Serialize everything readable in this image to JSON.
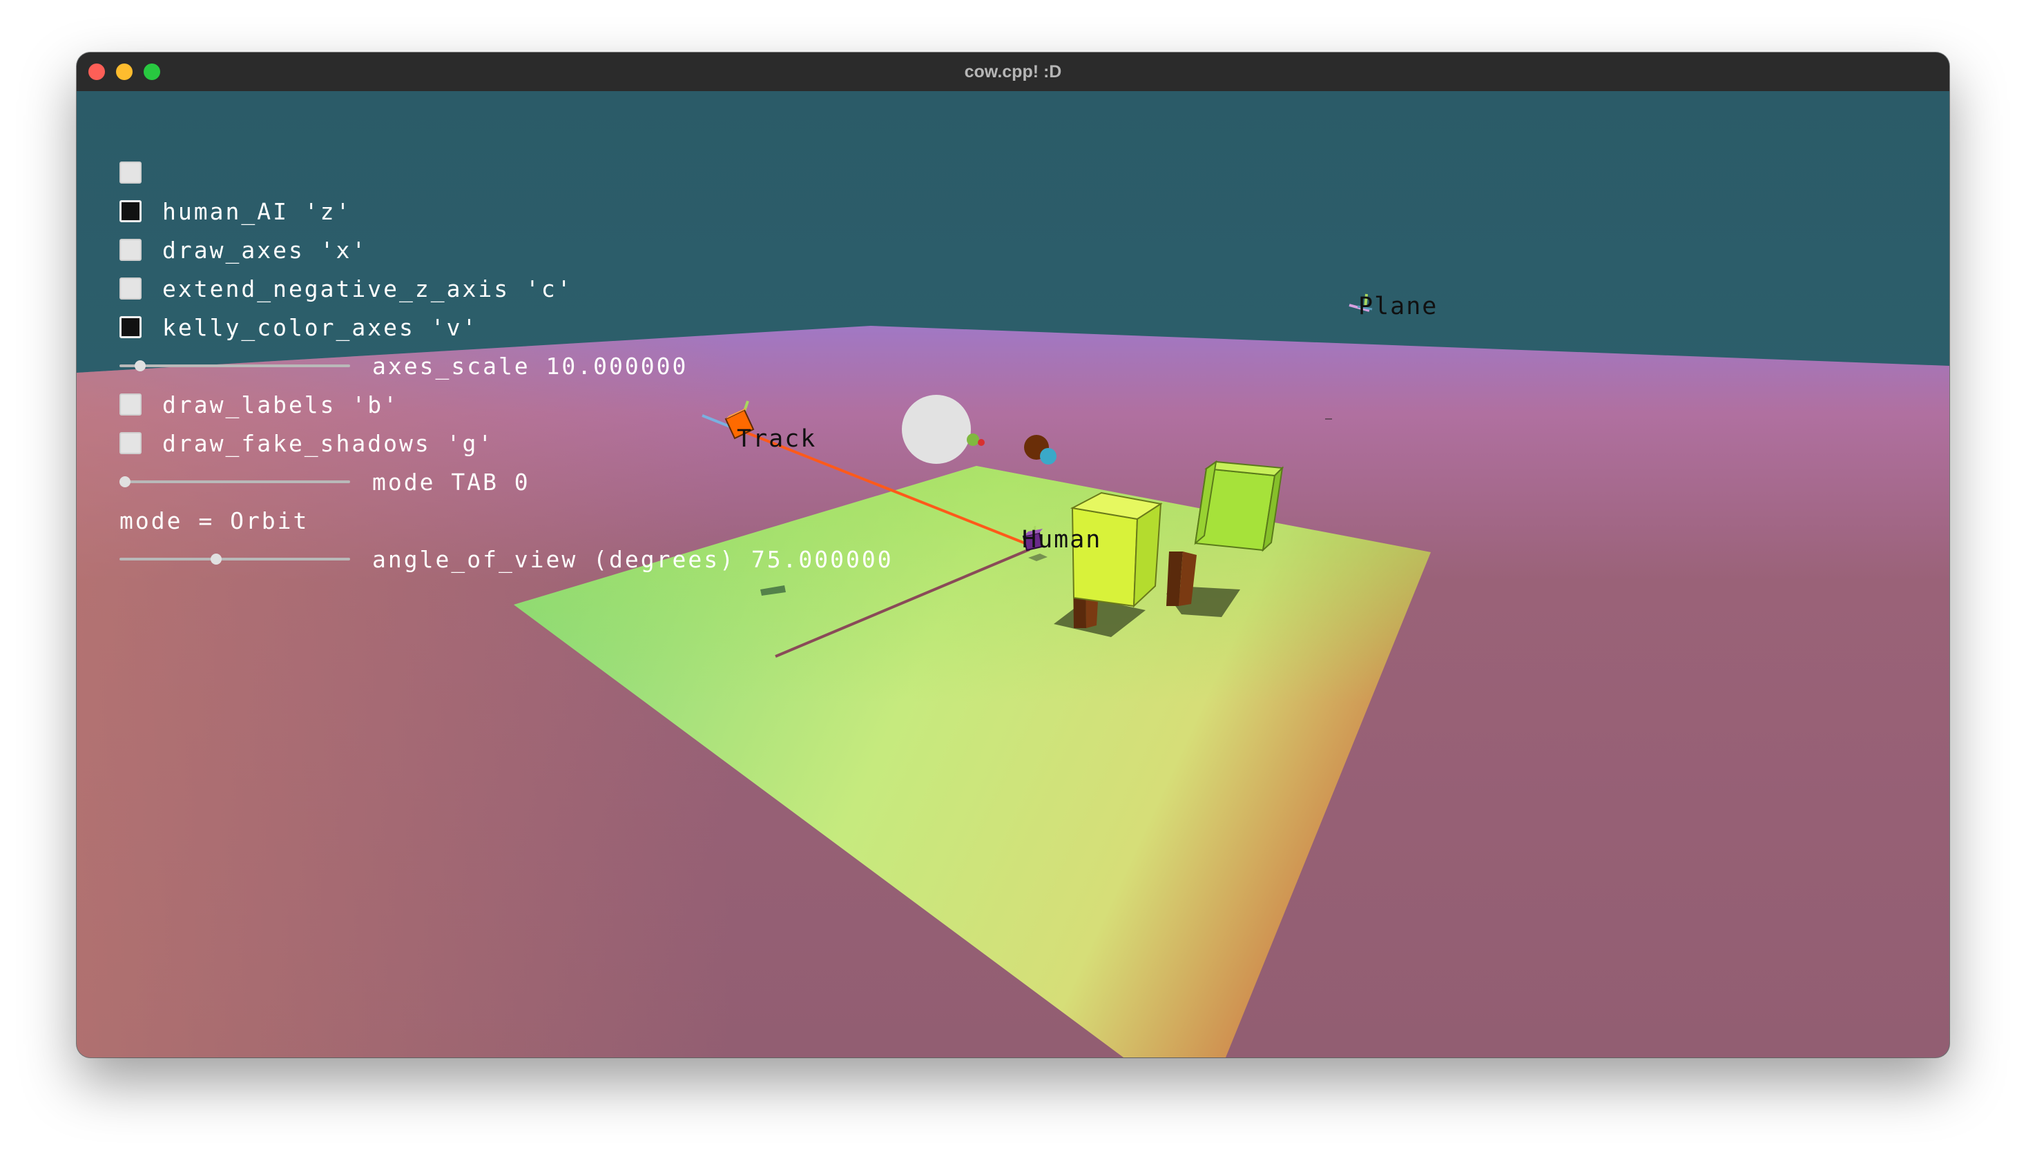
{
  "window": {
    "title": "cow.cpp! :D"
  },
  "gui": {
    "rows": [
      {
        "kind": "checkbox",
        "checked": false,
        "label": ""
      },
      {
        "kind": "checkbox",
        "checked": true,
        "label": "human_AI 'z'"
      },
      {
        "kind": "checkbox",
        "checked": false,
        "label": "draw_axes 'x'"
      },
      {
        "kind": "checkbox",
        "checked": false,
        "label": "extend_negative_z_axis 'c'"
      },
      {
        "kind": "checkbox",
        "checked": true,
        "label": "kelly_color_axes 'v'"
      },
      {
        "kind": "slider",
        "fraction": 0.09,
        "label": "axes_scale 10.000000"
      },
      {
        "kind": "checkbox",
        "checked": false,
        "label": "draw_labels 'b'"
      },
      {
        "kind": "checkbox",
        "checked": false,
        "label": "draw_fake_shadows 'g'"
      },
      {
        "kind": "slider",
        "fraction": 0.0,
        "label": "mode TAB 0"
      },
      {
        "kind": "text",
        "label": "mode = Orbit"
      },
      {
        "kind": "slider",
        "fraction": 0.42,
        "label": "angle_of_view (degrees) 75.000000"
      }
    ]
  },
  "scene_labels": {
    "track": "Track",
    "human": "Human",
    "plane": "Plane"
  },
  "colors": {
    "sky": "#2d5f6b",
    "ground": "#925e72",
    "horizon_purple": "#9f76c8",
    "grass_green": "#8fdb80",
    "grass_yellow": "#d0ec80",
    "grass_orange": "#cf8c4e",
    "tree_leaf_light": "#d8f23a",
    "tree_leaf": "#a8e23a",
    "tree_trunk": "#7a3a12",
    "track_cube": "#ff6a00",
    "human_cube": "#6a2a8a",
    "track_line": "#ff5a00",
    "moon": "#e2e2e2",
    "planet": "#6a2e08",
    "planet_moon": "#3aa9c8"
  }
}
